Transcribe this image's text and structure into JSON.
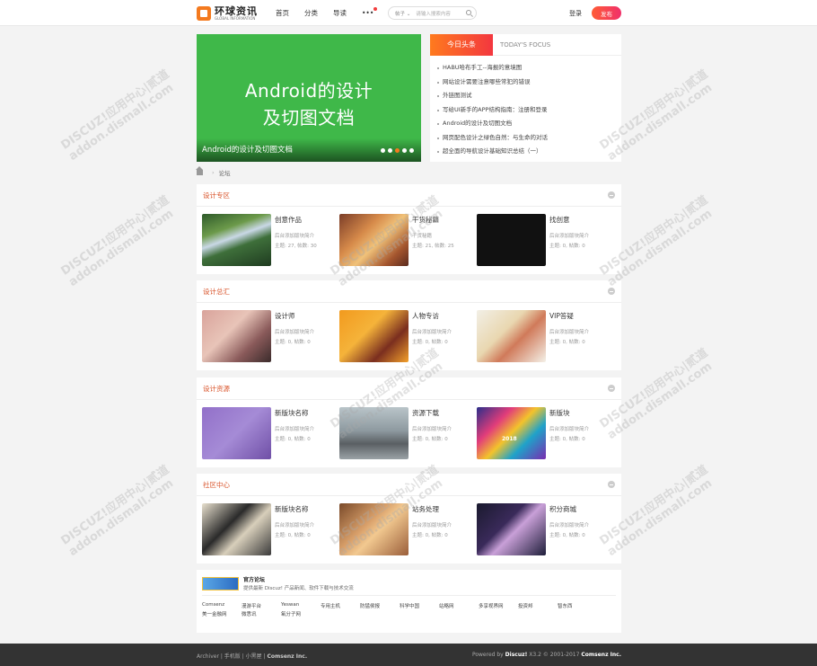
{
  "header": {
    "logo_cn": "环球资讯",
    "logo_en": "GLOBAL INFORMATION",
    "nav": [
      "首页",
      "分类",
      "导读",
      "•••"
    ],
    "search_select": "帖子",
    "search_placeholder": "请输入搜索内容",
    "login": "登录",
    "post": "发布"
  },
  "banner": {
    "big_line1": "Android的设计",
    "big_line2": "及切图文档",
    "caption": "Android的设计及切图文档",
    "bg_color": "#3fb849",
    "dot_count": 5,
    "active_dot": 3
  },
  "focus": {
    "tab": "今日头条",
    "sub": "TODAY'S FOCUS",
    "items": [
      "HABU哈布手工--海报的意境图",
      "网站设计需要注意哪些常犯的错误",
      "外链图测试",
      "写给UI新手的APP结构指南：注册和登录",
      "Android的设计及切图文档",
      "网页配色设计之绿色自然：与生命的对话",
      "超全面的导航设计基础知识总结（一）"
    ]
  },
  "breadcrumb": {
    "sep": "›",
    "current": "论坛"
  },
  "sections": [
    {
      "title": "设计专区",
      "forums": [
        {
          "name": "创意作品",
          "desc": "后台添加版块简介",
          "stats": "主题: 27, 帖数: 30",
          "thumb": "thumb-waterfall"
        },
        {
          "name": "干货秘籍",
          "desc": "干货秘籍",
          "stats": "主题: 21, 帖数: 25",
          "thumb": "thumb-illustration-room"
        },
        {
          "name": "找创意",
          "desc": "后台添加版块简介",
          "stats": "主题: 0, 帖数: 0",
          "thumb": "thumb-off-the-wall"
        }
      ]
    },
    {
      "title": "设计总汇",
      "forums": [
        {
          "name": "设计师",
          "desc": "后台添加版块简介",
          "stats": "主题: 0, 帖数: 0",
          "thumb": "thumb-cute-character"
        },
        {
          "name": "人物专访",
          "desc": "后台添加版块简介",
          "stats": "主题: 0, 帖数: 0",
          "thumb": "thumb-orange-portrait"
        },
        {
          "name": "VIP答疑",
          "desc": "后台添加版块简介",
          "stats": "主题: 0, 帖数: 0",
          "thumb": "thumb-street-sketch"
        }
      ]
    },
    {
      "title": "设计资源",
      "forums": [
        {
          "name": "新版块名称",
          "desc": "后台添加版块简介",
          "stats": "主题: 0, 帖数: 0",
          "thumb": "thumb-purple-lettering"
        },
        {
          "name": "资源下载",
          "desc": "后台添加版块简介",
          "stats": "主题: 0, 帖数: 0",
          "thumb": "thumb-sports-car"
        },
        {
          "name": "新版块",
          "desc": "后台添加版块简介",
          "stats": "主题: 0, 帖数: 0",
          "thumb": "thumb-colorful-poster",
          "thumb_text": "2018"
        }
      ]
    },
    {
      "title": "社区中心",
      "forums": [
        {
          "name": "新版块名称",
          "desc": "后台添加版块简介",
          "stats": "主题: 0, 帖数: 0",
          "thumb": "thumb-card-collage"
        },
        {
          "name": "站务处理",
          "desc": "后台添加版块简介",
          "stats": "主题: 0, 帖数: 0",
          "thumb": "thumb-lion"
        },
        {
          "name": "积分商城",
          "desc": "后台添加版块简介",
          "stats": "主题: 0, 帖数: 0",
          "thumb": "thumb-dark-space"
        }
      ]
    }
  ],
  "friend_links": {
    "official_title": "官方论坛",
    "official_desc": "提供最新 Discuz! 产品新闻、软件下载与技术交流",
    "links": [
      "Comsenz",
      "漫游平台",
      "Yeswan",
      "专用主机",
      "防猛侯报",
      "科学中国",
      "站略网",
      "多享视界网",
      "投资邦",
      "智东西",
      "美一金融网",
      "微悉讯",
      "氧分子网"
    ]
  },
  "footer": {
    "left_links": [
      "Archiver",
      "手机版",
      "小黑屋"
    ],
    "left_company": "Comsenz Inc.",
    "powered": "Powered by",
    "brand": "Discuz!",
    "version": "X3.2",
    "copyright": "© 2001-2017",
    "company": "Comsenz Inc."
  },
  "watermark": {
    "line1": "DISCUZ!应用中心|贰道",
    "line2": "addon.dismall.com"
  }
}
